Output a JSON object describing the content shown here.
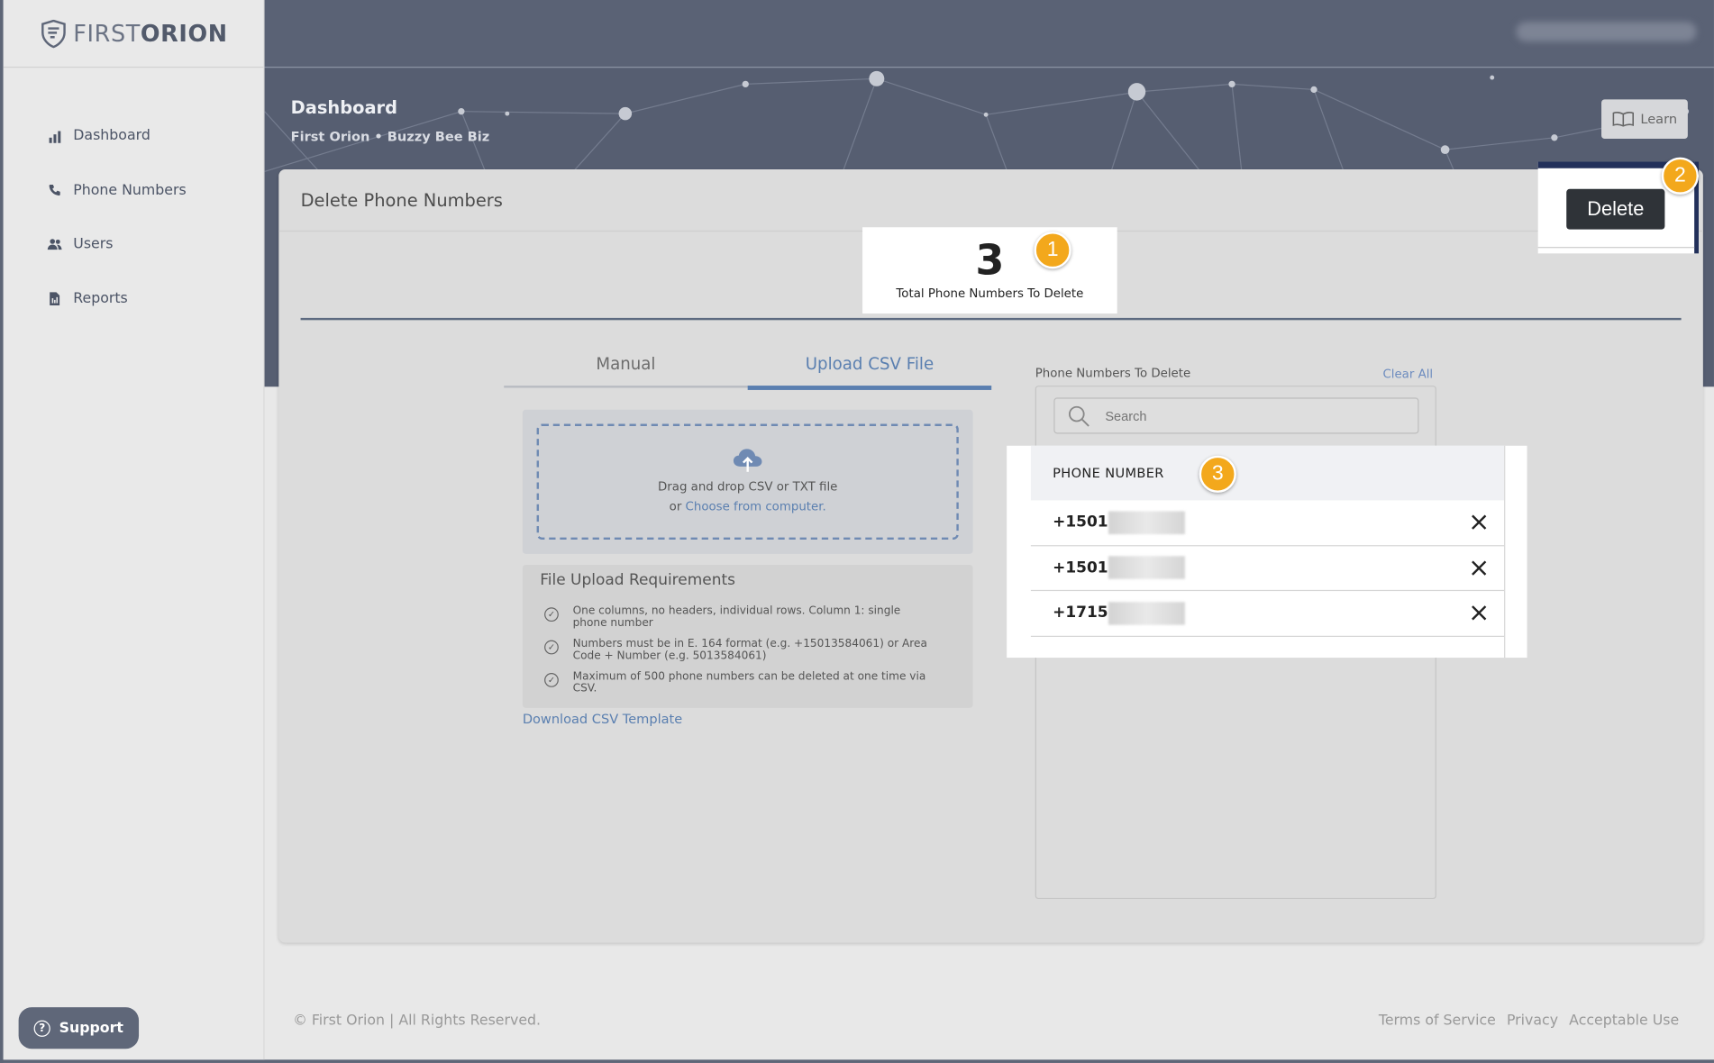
{
  "brand": {
    "light": "FIRST",
    "bold": "ORION"
  },
  "sidebar": {
    "items": [
      {
        "label": "Dashboard",
        "icon": "bar-chart-icon"
      },
      {
        "label": "Phone Numbers",
        "icon": "phone-icon"
      },
      {
        "label": "Users",
        "icon": "users-icon"
      },
      {
        "label": "Reports",
        "icon": "report-icon"
      }
    ],
    "support_label": "Support"
  },
  "header": {
    "title": "Dashboard",
    "breadcrumb": "First Orion • Buzzy Bee Biz",
    "learn_label": "Learn"
  },
  "card": {
    "title": "Delete Phone Numbers",
    "total_count": "3",
    "total_label": "Total Phone Numbers To Delete",
    "delete_label": "Delete"
  },
  "tabs": [
    {
      "label": "Manual",
      "active": false
    },
    {
      "label": "Upload CSV File",
      "active": true
    }
  ],
  "upload": {
    "dropzone_line1": "Drag and drop CSV or TXT file",
    "dropzone_or": "or ",
    "dropzone_link": "Choose from computer.",
    "requirements_title": "File Upload Requirements",
    "requirements": [
      "One columns, no headers, individual rows. Column 1: single phone number",
      "Numbers must be in E. 164 format (e.g. +15013584061) or Area Code + Number (e.g. 5013584061)",
      "Maximum of 500 phone numbers can be deleted at one time via CSV."
    ],
    "download_label": "Download CSV Template"
  },
  "phone_list": {
    "label": "Phone Numbers To Delete",
    "clear_all": "Clear All",
    "search_placeholder": "Search",
    "column_header": "PHONE NUMBER",
    "rows": [
      "+1501",
      "+1501",
      "+1715"
    ]
  },
  "badges": [
    "1",
    "2",
    "3"
  ],
  "footer": {
    "copyright": "© First Orion | All Rights Reserved.",
    "links": [
      "Terms of Service",
      "Privacy",
      "Acceptable Use"
    ]
  },
  "colors": {
    "accent": "#5a7fb0",
    "badge": "#f3a81c",
    "header": "#5a6275",
    "delete": "#2f3338"
  }
}
